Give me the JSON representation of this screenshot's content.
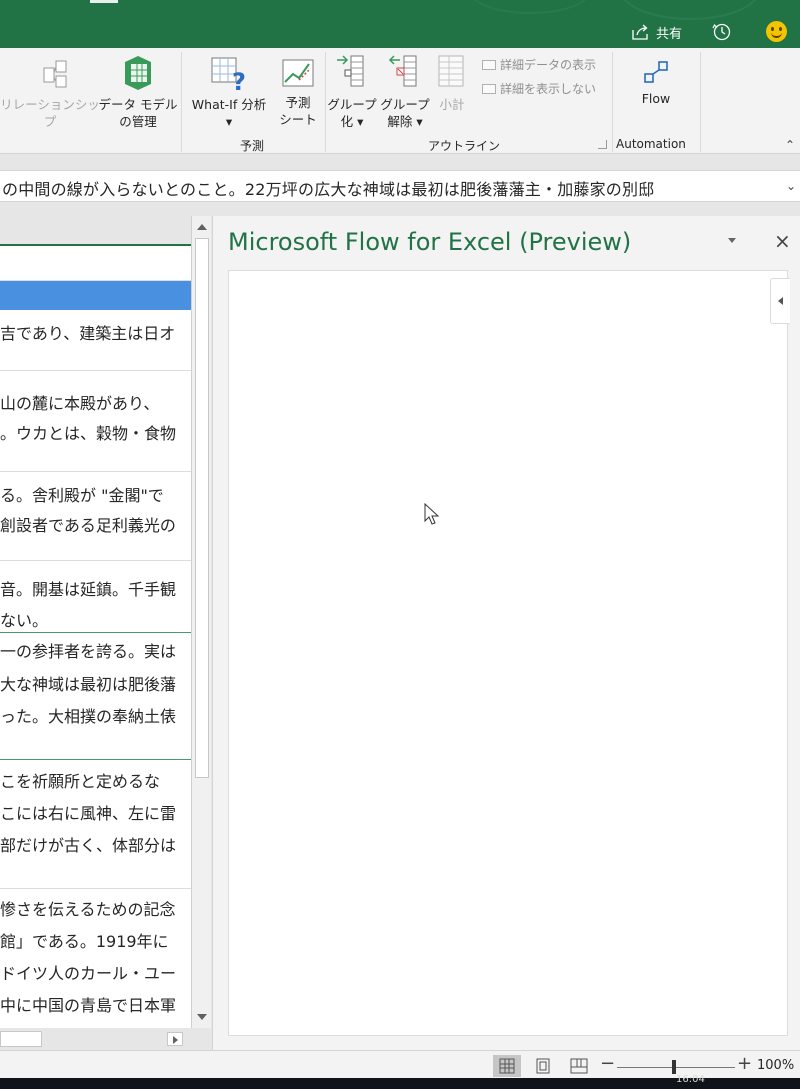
{
  "titlebar": {
    "share_label": "共有"
  },
  "ribbon": {
    "relationships_label": "リレーションシップ",
    "data_model_line1": "データ モデル",
    "data_model_line2": "の管理",
    "whatif_line1": "What-If 分析",
    "whatif_line2": "▾",
    "forecast_line1": "予測",
    "forecast_line2": "シート",
    "group_line1": "グループ",
    "group_line2": "化 ▾",
    "ungroup_line1": "グループ",
    "ungroup_line2": "解除 ▾",
    "subtotal_label": "小計",
    "show_detail_label": "詳細データの表示",
    "hide_detail_label": "詳細を表示しない",
    "flow_label": "Flow",
    "group_forecast": "予測",
    "group_outline": "アウトライン",
    "group_automation": "Automation"
  },
  "formula_bar": {
    "text": "の中間の線が入らないとのこと。22万坪の広大な神域は最初は肥後藩藩主・加藤家の別邸"
  },
  "sheet": {
    "rows": [
      "吉であり、建築主は日オ",
      "山の麓に本殿があり、",
      "。ウカとは、穀物・食物",
      "る。舎利殿が \"金閣\"で",
      "創設者である足利義光の",
      "音。開基は延鎮。千手観",
      "ない。",
      "一の参拝者を誇る。実は",
      "大な神域は最初は肥後藩",
      "った。大相撲の奉納土俵",
      "こを祈願所と定めるな",
      "こには右に風神、左に雷",
      "部だけが古く、体部分は",
      "惨さを伝えるための記念",
      "館」である。1919年に",
      "ドイツ人のカール・ユー",
      "中に中国の青島で日本軍"
    ]
  },
  "pane": {
    "title": "Microsoft Flow for Excel (Preview)"
  },
  "status": {
    "zoom": "100%",
    "zoom_minus": "−",
    "zoom_plus": "+",
    "zoom_fraction": 0.47
  },
  "taskbar": {
    "clock": "16:04"
  },
  "colors": {
    "accent": "#217346",
    "selection": "#4a90e0"
  }
}
